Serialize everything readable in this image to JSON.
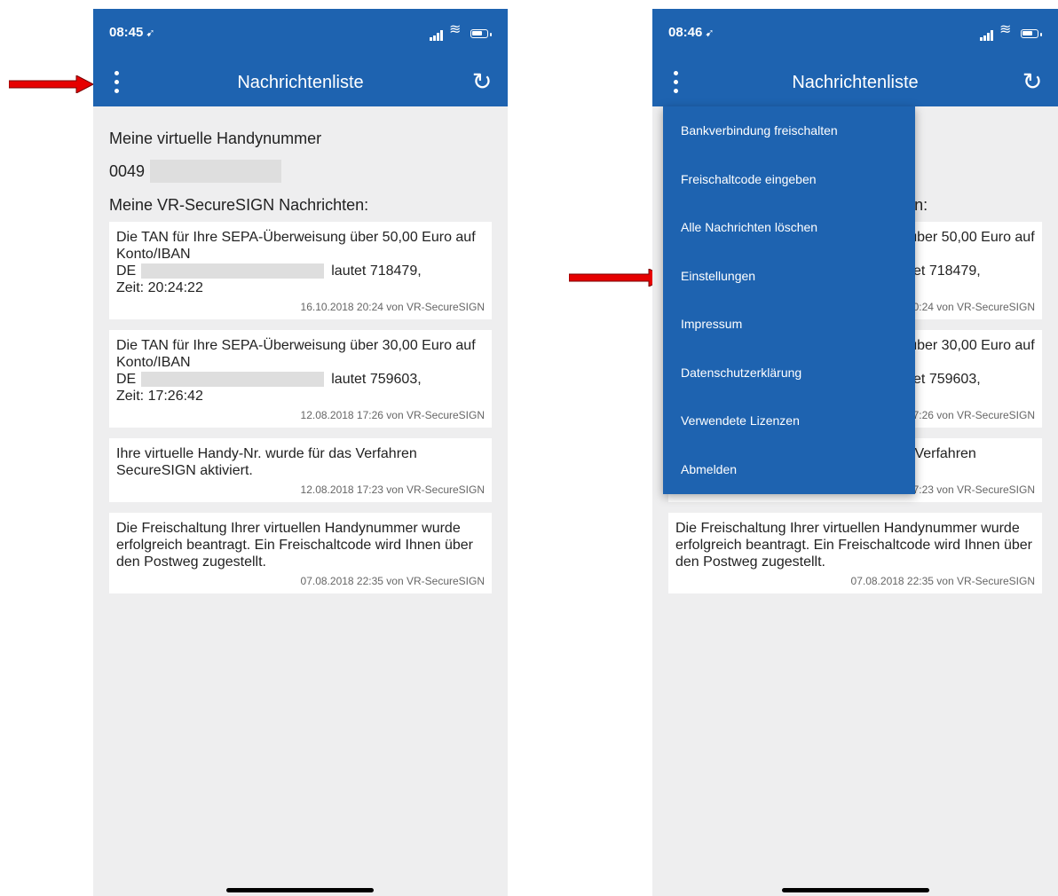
{
  "colors": {
    "brand": "#1e63b0",
    "arrow": "#e60000",
    "background": "#eeeeef"
  },
  "screens": [
    {
      "status": {
        "time": "08:45"
      },
      "header": {
        "title": "Nachrichtenliste"
      },
      "number_label": "Meine virtuelle Handynummer",
      "number_prefix": "0049",
      "messages_label": "Meine VR-SecureSIGN Nachrichten:",
      "messages": [
        {
          "line1": "Die TAN für Ihre SEPA-Überweisung über 50,00 Euro auf Konto/IBAN",
          "iban_prefix": "DE",
          "iban_suffix": "lautet 718479,",
          "line3": "Zeit: 20:24:22",
          "meta": "16.10.2018 20:24 von VR-SecureSIGN"
        },
        {
          "line1": "Die TAN für Ihre SEPA-Überweisung über 30,00 Euro auf Konto/IBAN",
          "iban_prefix": "DE",
          "iban_suffix": "lautet 759603,",
          "line3": "Zeit: 17:26:42",
          "meta": "12.08.2018 17:26 von VR-SecureSIGN"
        },
        {
          "text": "Ihre virtuelle Handy-Nr. wurde für das Verfahren SecureSIGN aktiviert.",
          "meta": "12.08.2018 17:23 von VR-SecureSIGN"
        },
        {
          "text": "Die Freischaltung Ihrer virtuellen Handynummer wurde erfolgreich beantragt. Ein Freischaltcode wird Ihnen über den Postweg zugestellt.",
          "meta": "07.08.2018 22:35 von VR-SecureSIGN"
        }
      ]
    },
    {
      "status": {
        "time": "08:46"
      },
      "header": {
        "title": "Nachrichtenliste"
      },
      "menu": [
        "Bankverbindung freischalten",
        "Freischaltcode eingeben",
        "Alle Nachrichten löschen",
        "Einstellungen",
        "Impressum",
        "Datenschutzerklärung",
        "Verwendete Lizenzen",
        "Abmelden"
      ]
    }
  ]
}
